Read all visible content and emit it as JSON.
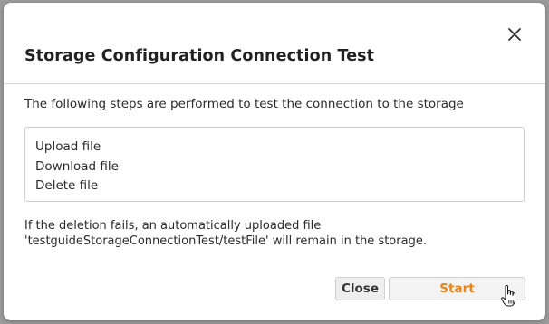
{
  "dialog": {
    "title": "Storage Configuration Connection Test",
    "intro": "The following steps are performed to test the connection to the storage",
    "steps": [
      "Upload file",
      "Download file",
      "Delete file"
    ],
    "note_line1": "If the deletion fails, an automatically uploaded file",
    "note_line2": "'testguideStorageConnectionTest/testFile' will remain in the storage.",
    "close_label": "Close",
    "start_label": "Start"
  },
  "colors": {
    "accent": "#e8821b",
    "overlay": "#9a9a9a"
  },
  "icons": {
    "close": "close-icon",
    "cursor": "hand-pointer-icon"
  }
}
